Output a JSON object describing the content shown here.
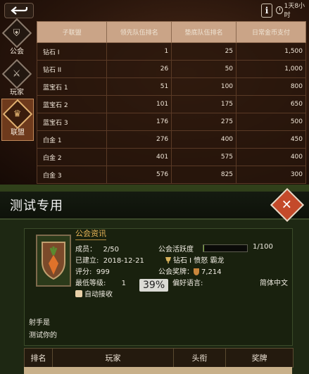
{
  "top": {
    "timer": "1天8小时",
    "sidebar": [
      {
        "label": "公会",
        "icon": "shield-icon",
        "active": false
      },
      {
        "label": "玩家",
        "icon": "sword-icon",
        "active": false
      },
      {
        "label": "联盟",
        "icon": "trophy-icon",
        "active": true
      }
    ],
    "table": {
      "headers": [
        "子联盟",
        "领先队伍排名",
        "垫底队伍排名",
        "日常金币支付"
      ],
      "rows": [
        [
          "钻石 I",
          "1",
          "25",
          "1,500"
        ],
        [
          "钻石 II",
          "26",
          "50",
          "1,000"
        ],
        [
          "蓝宝石 1",
          "51",
          "100",
          "800"
        ],
        [
          "蓝宝石 2",
          "101",
          "175",
          "650"
        ],
        [
          "蓝宝石 3",
          "176",
          "275",
          "500"
        ],
        [
          "白金 1",
          "276",
          "400",
          "450"
        ],
        [
          "白金 2",
          "401",
          "575",
          "400"
        ],
        [
          "白金 3",
          "576",
          "825",
          "300"
        ]
      ]
    }
  },
  "dialog": {
    "title": "测试专用",
    "section_title": "公会资讯",
    "members_label": "成员：",
    "members_value": "2/50",
    "activity_label": "公会活跃度",
    "activity_value": "1/100",
    "activity_fraction": 0.01,
    "founded_label": "已建立:",
    "founded_value": "2018-12-21",
    "league_text": "钻石 I 愤怒 霸龙",
    "score_label": "评分:",
    "score_value": "999",
    "medals_label": "公会奖牌：",
    "medals_value": "7,214",
    "min_level_label": "最低等级:",
    "min_level_value": "1",
    "language_label": "偏好语言:",
    "language_value": "简体中文",
    "auto_accept_label": "自动接收",
    "progress_overlay": "39%",
    "description_line1": "射手是",
    "description_line2": "测试你的",
    "columns": [
      "排名",
      "玩家",
      "头衔",
      "奖牌"
    ]
  }
}
